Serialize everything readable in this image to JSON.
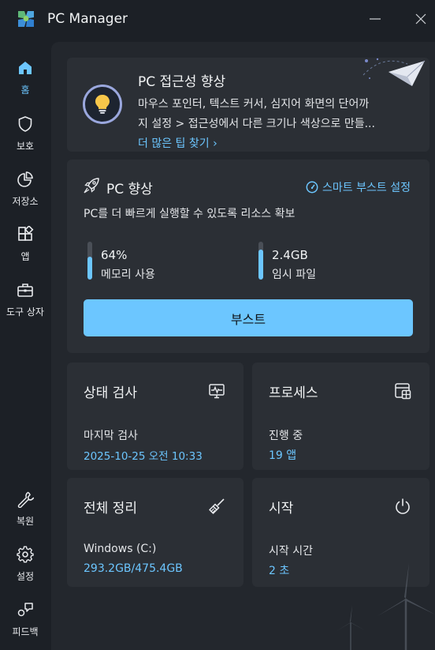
{
  "app": {
    "title": "PC Manager"
  },
  "nav": {
    "home": "홈",
    "protect": "보호",
    "storage": "저장소",
    "apps": "앱",
    "toolbox": "도구 상자",
    "repair": "복원",
    "settings": "설정",
    "feedback": "피드백"
  },
  "tip": {
    "title": "PC 접근성 향상",
    "line1": "마우스 포인터, 텍스트 커서, 심지어 화면의 단어까",
    "line2": "지 설정 > 접근성에서 다른 크기나 색상으로 만들...",
    "link": "더 많은 팁 찾기 ›"
  },
  "boost": {
    "title": "PC 향상",
    "smart_link": "스마트 부스트 설정",
    "description": "PC를 더 빠르게 실행할 수 있도록 리소스 확보",
    "memory_value": "64%",
    "memory_label": "메모리 사용",
    "memory_fill": 0.6,
    "temp_value": "2.4GB",
    "temp_label": "임시 파일",
    "temp_fill": 0.8,
    "button": "부스트"
  },
  "health": {
    "title": "상태 검사",
    "label": "마지막 검사",
    "value": "2025-10-25 오전 10:33"
  },
  "process": {
    "title": "프로세스",
    "label": "진행 중",
    "value": "19 앱"
  },
  "cleanup": {
    "title": "전체 정리",
    "label": "Windows (C:)",
    "value": "293.2GB/475.4GB"
  },
  "startup": {
    "title": "시작",
    "label": "시작 시간",
    "value": "2 초"
  },
  "colors": {
    "accent": "#6cc6ff",
    "background": "#1c2026",
    "panel": "#23272d",
    "card": "#2b2f35"
  }
}
